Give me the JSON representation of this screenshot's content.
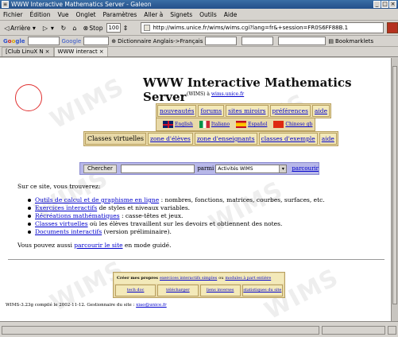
{
  "window": {
    "title": "WWW Interactive Mathematics Server - Galeon"
  },
  "menu": [
    "Fichier",
    "Édition",
    "Vue",
    "Onglet",
    "Paramètres",
    "Aller à",
    "Signets",
    "Outils",
    "Aide"
  ],
  "toolbar": {
    "back_label": "Arrière",
    "stop_label": "Stop",
    "zoom_value": "100",
    "url": "http://wims.unice.fr/wims/wims.cgi?lang=fr&+session=FR0S6FF88B.1"
  },
  "bookmarks_bar": {
    "search_label": "Google",
    "dictionary_label": "Dictionnaire Anglais->Français",
    "bookmarklets_label": "Bookmarklets"
  },
  "tabs": [
    {
      "label": "[Club LinuX N"
    },
    {
      "label": "WWW interact"
    }
  ],
  "page": {
    "title": "WWW Interactive Mathematics Server",
    "subtitle_prefix": "(WIMS) à",
    "subtitle_link": "wims.unice.fr",
    "watermark": "WIMS",
    "top_links": [
      "nouveautés",
      "forums",
      "sites miroirs",
      "préférences",
      "aide"
    ],
    "languages": [
      {
        "label": "English",
        "icon": "uk-flag-icon"
      },
      {
        "label": "Italiano",
        "icon": "italy-flag-icon"
      },
      {
        "label": "Español",
        "icon": "spain-flag-icon"
      },
      {
        "label": "Chinese gb",
        "icon": "china-flag-icon"
      }
    ],
    "zones": [
      "Classes virtuelles",
      "zone d'élèves",
      "zone d'enseignants",
      "classes d'exemple",
      "aide"
    ],
    "search": {
      "button_label": "Chercher",
      "in_label": "parmi",
      "select_value": "Activités WIMS",
      "link_label": "parcourir"
    },
    "intro": "Sur ce site, vous trouverez:",
    "items": [
      {
        "link": "Outils de calcul et de graphisme en ligne",
        "text": " : nombres, fonctions, matrices, courbes, surfaces, etc."
      },
      {
        "link": "Exercices interactifs",
        "text": " de styles et niveaux variables."
      },
      {
        "link": "Récréations mathématiques",
        "text": " : casse-têtes et jeux."
      },
      {
        "link": "Classes virtuelles",
        "text": " où les élèves travaillent sur les devoirs et obtiennent des notes."
      },
      {
        "link": "Documents interactifs",
        "text": " (version préliminaire)."
      }
    ],
    "guided": {
      "prefix": "Vous pouvez aussi ",
      "link": "parcourir le site",
      "suffix": " en mode guidé."
    },
    "create": {
      "prefix": "Créer mes propres",
      "link1": "exercices interactifs simples",
      "middle": "ou",
      "link2": "modules à part entière"
    },
    "create_links": [
      "tech doc",
      "télécharger",
      "liens inverses",
      "statistiques du site"
    ],
    "footer": {
      "text": "WIMS-3.23g compilé le 2002-11-12. Gestionnaire du site : ",
      "link": "xiao@unice.fr"
    }
  }
}
